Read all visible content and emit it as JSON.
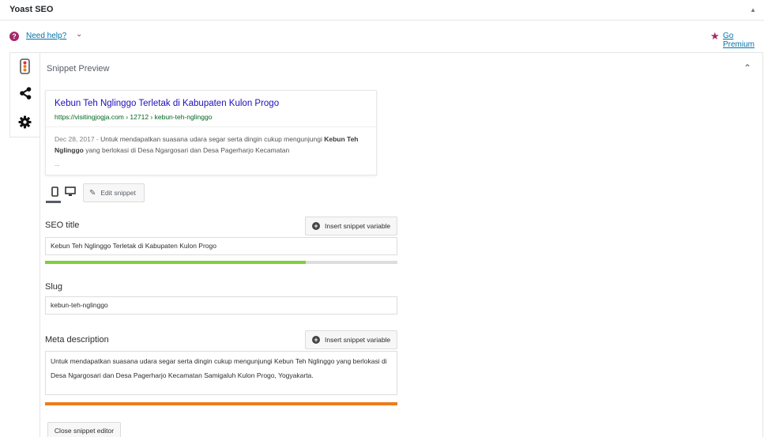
{
  "metabox": {
    "title": "Yoast SEO",
    "toggle_icon": "triangle-up-icon",
    "help_link": "Need help?",
    "premium_link": "Go Premium",
    "colors": {
      "brand": "#a4286a",
      "link": "#0073aa"
    }
  },
  "tabs": [
    {
      "icon": "traffic-light-icon",
      "active": true
    },
    {
      "icon": "share-icon",
      "active": false
    },
    {
      "icon": "gear-icon",
      "active": false
    }
  ],
  "snippet": {
    "panel_title": "Snippet Preview",
    "preview": {
      "title": "Kebun Teh Nglinggo Terletak di Kabupaten Kulon Progo",
      "url": "https://visitingjogja.com › 12712 › kebun-teh-nglinggo",
      "date": "Dec 28, 2017",
      "desc_part1": "Untuk mendapatkan suasana udara segar serta dingin cukup mengunjungi",
      "desc_bold": "Kebun Teh Nglinggo",
      "desc_part2": "yang berlokasi di Desa Ngargosari dan Desa Pagerharjo Kecamatan",
      "ellipsis": "..."
    },
    "mode": "mobile",
    "edit_label": "Edit snippet"
  },
  "form": {
    "seo_title": {
      "label": "SEO title",
      "value": "Kebun Teh Nglinggo Terletak di Kabupaten Kulon Progo",
      "progress": 0.74,
      "progress_color": "#7ad03a"
    },
    "insert_variable_label": "Insert snippet variable",
    "slug": {
      "label": "Slug",
      "value": "kebun-teh-nglinggo"
    },
    "meta_description": {
      "label": "Meta description",
      "value": "Untuk mendapatkan suasana udara segar serta dingin cukup mengunjungi Kebun Teh Nglinggo yang berlokasi di Desa Ngargosari dan Desa Pagerharjo Kecamatan Samigaluh Kulon Progo, Yogyakarta.",
      "progress": 1.0,
      "progress_color": "#ee7c1b"
    },
    "close_label": "Close snippet editor"
  }
}
